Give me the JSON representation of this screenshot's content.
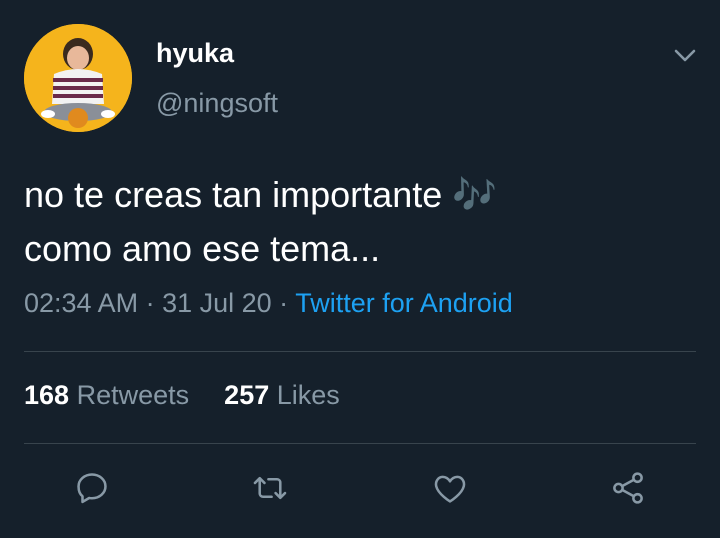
{
  "user": {
    "display_name": "hyuka",
    "handle": "@ningsoft"
  },
  "tweet": {
    "line1": "no te creas tan importante",
    "emoji": "🎶",
    "line2": "como amo ese tema..."
  },
  "meta": {
    "time": "02:34 AM",
    "sep1": " · ",
    "date": "31 Jul 20",
    "sep2": " · ",
    "source": "Twitter for Android"
  },
  "stats": {
    "retweets": "168",
    "retweets_label": "Retweets",
    "likes": "257",
    "likes_label": "Likes"
  },
  "actions": [
    "reply-icon",
    "retweet-icon",
    "like-icon",
    "share-icon"
  ],
  "colors": {
    "background": "#15202b",
    "secondary_text": "#8899a6",
    "link": "#1da1f2",
    "divider": "#38444d",
    "avatar_bg": "#f5b41c"
  }
}
